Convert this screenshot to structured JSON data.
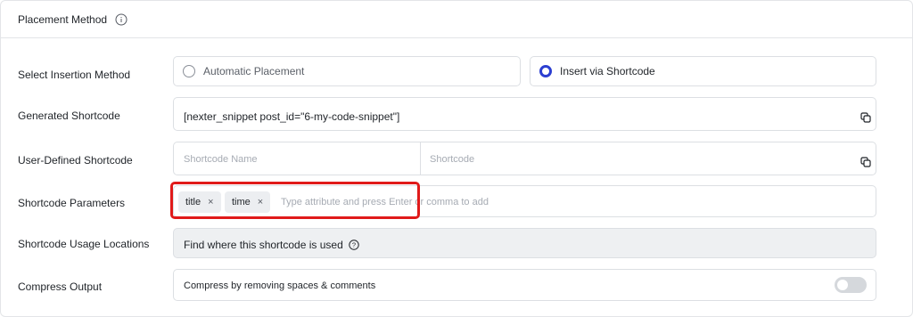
{
  "header": {
    "title": "Placement Method",
    "info_icon": "info-circle-icon"
  },
  "rows": {
    "insertion": {
      "label": "Select Insertion Method",
      "options": [
        {
          "label": "Automatic Placement",
          "selected": false
        },
        {
          "label": "Insert via Shortcode",
          "selected": true
        }
      ]
    },
    "generated": {
      "label": "Generated Shortcode",
      "value": "[nexter_snippet post_id=\"6-my-code-snippet\"]",
      "icon": "copy-icon"
    },
    "user_defined": {
      "label": "User-Defined Shortcode",
      "name_placeholder": "Shortcode Name",
      "shortcode_placeholder": "Shortcode",
      "icon": "copy-icon"
    },
    "parameters": {
      "label": "Shortcode Parameters",
      "tags": [
        "title",
        "time"
      ],
      "remove_glyph": "×",
      "placeholder": "Type attribute and press Enter or comma to add"
    },
    "usage": {
      "label": "Shortcode Usage Locations",
      "text": "Find where this shortcode is used",
      "icon": "help-circle-icon"
    },
    "compress": {
      "label": "Compress Output",
      "text": "Compress by removing spaces & comments",
      "enabled": false
    }
  },
  "colors": {
    "accent": "#2c3fd1",
    "highlight": "#e01a1a",
    "border": "#dcdfe3"
  }
}
